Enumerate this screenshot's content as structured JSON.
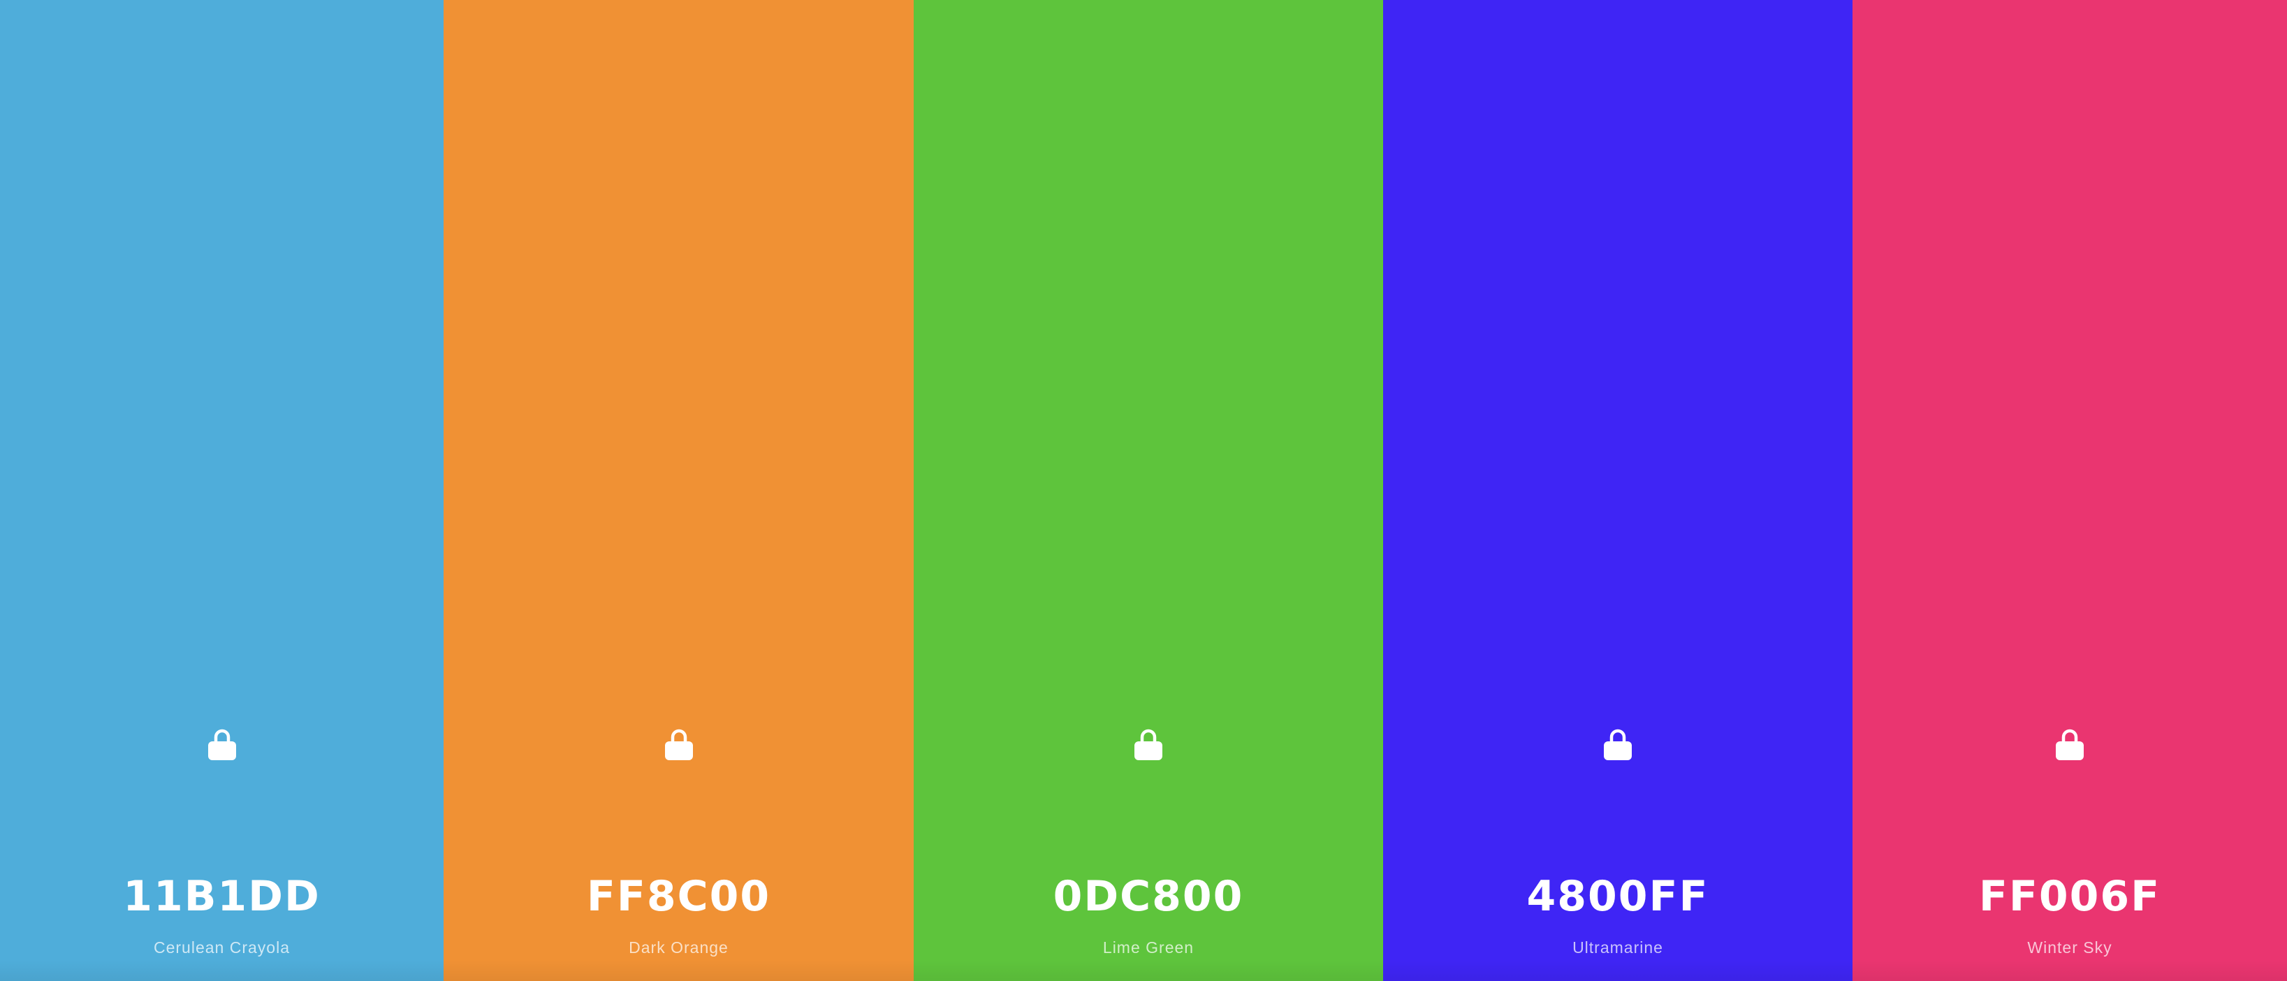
{
  "palette": {
    "colors": [
      {
        "hex": "11B1DD",
        "name": "Cerulean Crayola",
        "swatch_color": "#4FADDA",
        "locked": true,
        "lock_icon": "lock-icon"
      },
      {
        "hex": "FF8C00",
        "name": "Dark Orange",
        "swatch_color": "#F09134",
        "locked": true,
        "lock_icon": "lock-icon"
      },
      {
        "hex": "0DC800",
        "name": "Lime Green",
        "swatch_color": "#5EC43C",
        "locked": true,
        "lock_icon": "lock-icon"
      },
      {
        "hex": "4800FF",
        "name": "Ultramarine",
        "swatch_color": "#3F25F5",
        "locked": true,
        "lock_icon": "lock-icon"
      },
      {
        "hex": "FF006F",
        "name": "Winter Sky",
        "swatch_color": "#EA3570",
        "locked": true,
        "lock_icon": "lock-icon"
      }
    ]
  }
}
